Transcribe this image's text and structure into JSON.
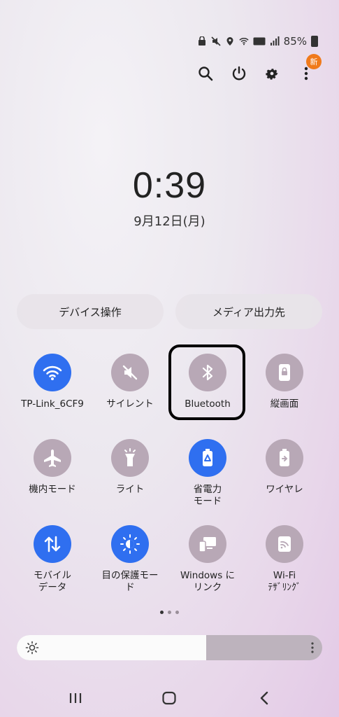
{
  "status_bar": {
    "battery_text": "85%",
    "icons": [
      "security-icon",
      "mute-icon",
      "location-icon",
      "wifi-icon",
      "volte-icon",
      "signal-icon",
      "battery-icon"
    ]
  },
  "top_actions": {
    "icons": [
      "search-icon",
      "power-icon",
      "gear-icon",
      "more-icon"
    ],
    "new_badge": "新"
  },
  "clock": {
    "time": "0:39",
    "date": "9月12日(月)"
  },
  "buttons": {
    "device_control": "デバイス操作",
    "media_output": "メディア出力先"
  },
  "tiles": [
    {
      "label": "TP-Link_6CF9",
      "icon": "wifi-icon",
      "state": "on"
    },
    {
      "label": "サイレント",
      "icon": "mute-icon",
      "state": "off"
    },
    {
      "label": "Bluetooth",
      "icon": "bluetooth-icon",
      "state": "off"
    },
    {
      "label": "縦画面",
      "icon": "portrait-lock-icon",
      "state": "off"
    },
    {
      "label": "機内モード",
      "icon": "airplane-icon",
      "state": "off"
    },
    {
      "label": "ライト",
      "icon": "flashlight-icon",
      "state": "off"
    },
    {
      "label": "省電力\nモード",
      "icon": "power-saving-icon",
      "state": "on"
    },
    {
      "label": "ワイヤレ",
      "icon": "wireless-powershare-icon",
      "state": "off"
    },
    {
      "label": "モバイル\nデータ",
      "icon": "mobile-data-icon",
      "state": "on"
    },
    {
      "label": "目の保護モー\nド",
      "icon": "eye-comfort-icon",
      "state": "on"
    },
    {
      "label": "Windows に\nリンク",
      "icon": "link-to-windows-icon",
      "state": "off"
    },
    {
      "label": "Wi-Fi\nﾃｻﾞﾘﾝｸﾞ",
      "icon": "wifi-hotspot-icon",
      "state": "off"
    }
  ],
  "pager": {
    "pages": 3,
    "current": 1
  },
  "brightness": {
    "level": 0.62
  },
  "colors": {
    "active": "#2f6ff0",
    "inactive": "#b8a8b6",
    "badge": "#f07a1b"
  }
}
